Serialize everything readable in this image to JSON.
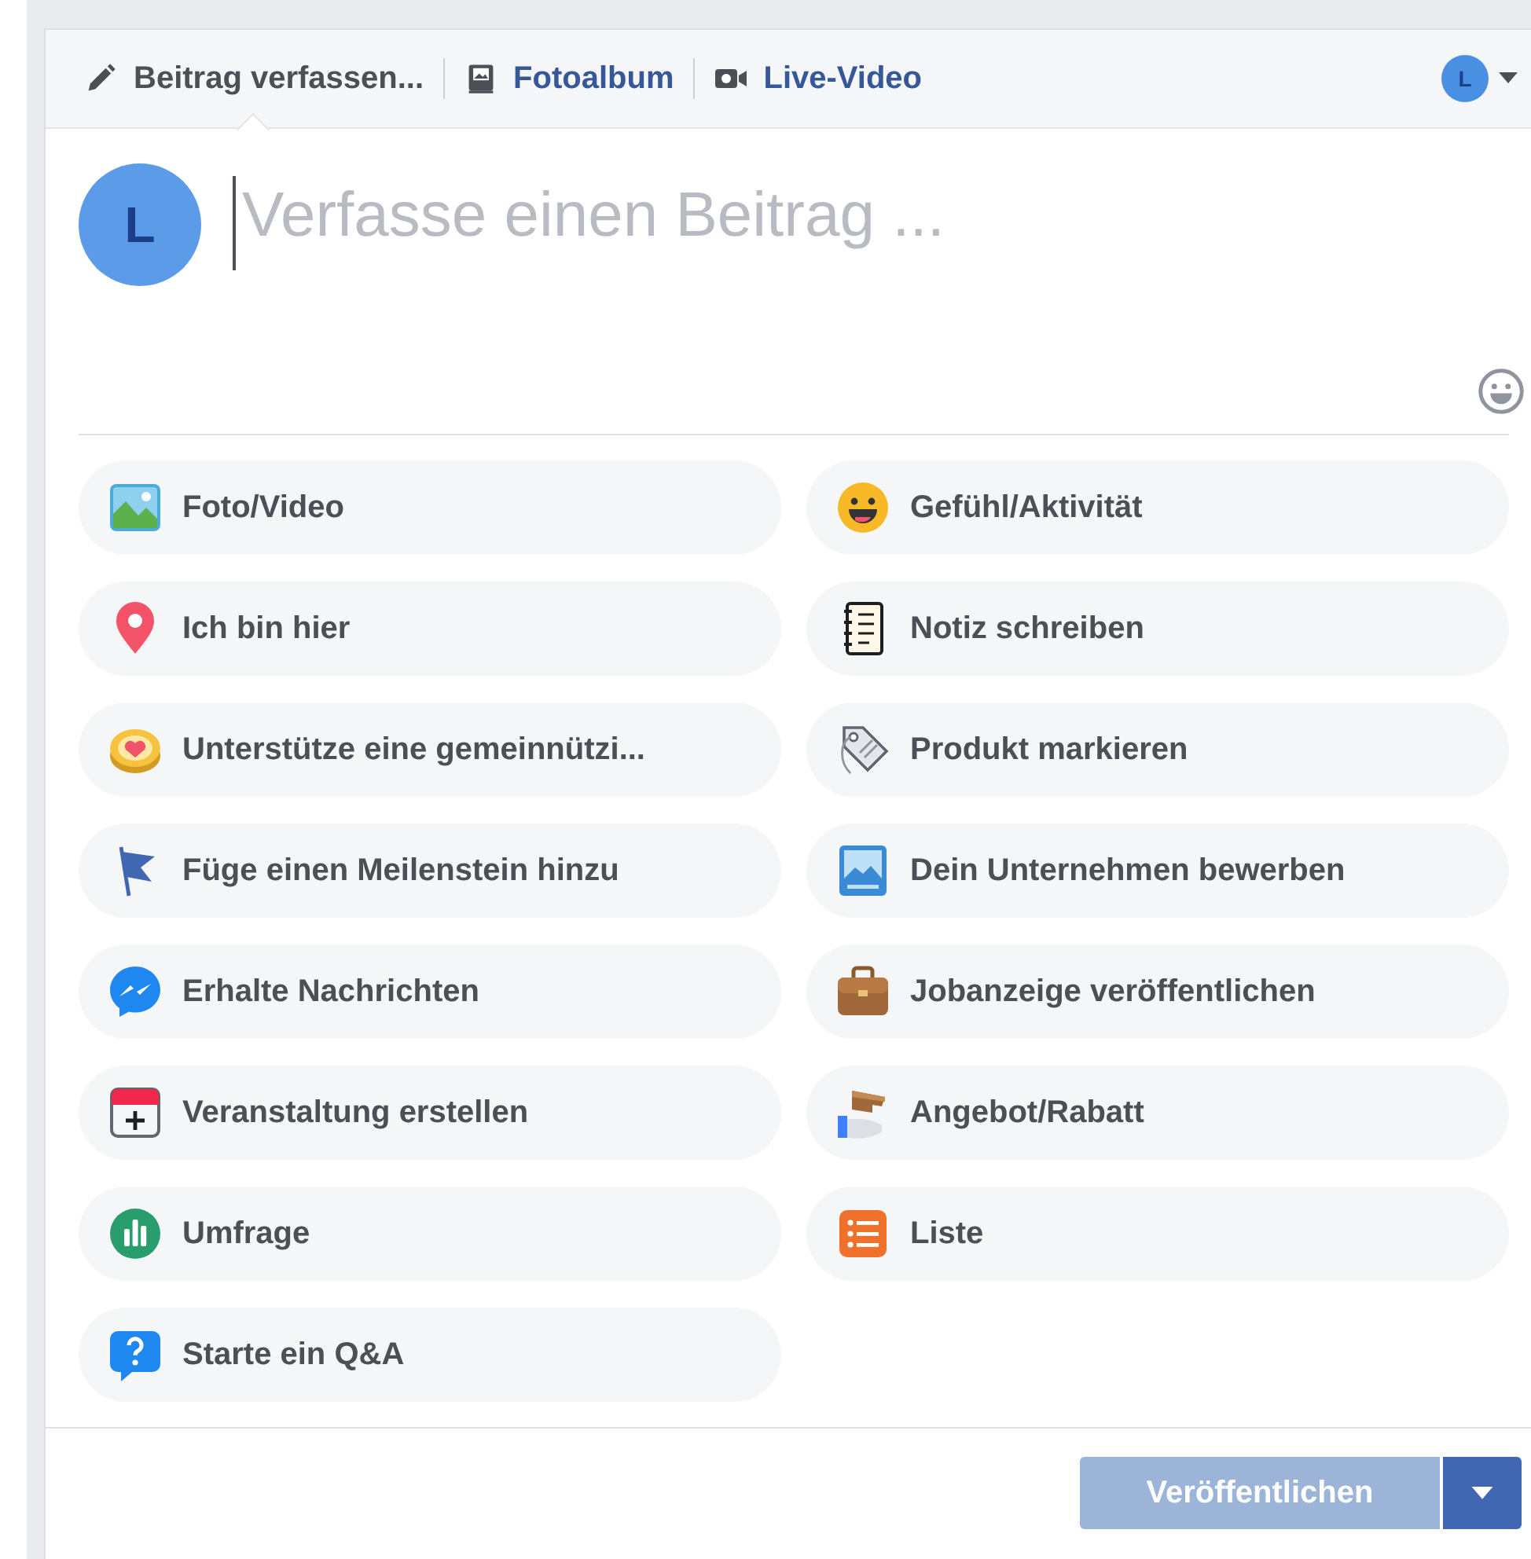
{
  "tabs": [
    {
      "label": "Beitrag verfassen...",
      "selected": true
    },
    {
      "label": "Fotoalbum",
      "selected": false
    },
    {
      "label": "Live-Video",
      "selected": false
    }
  ],
  "account": {
    "avatar_letter": "L"
  },
  "composer": {
    "avatar_letter": "L",
    "placeholder": "Verfasse einen Beitrag ..."
  },
  "actions": [
    {
      "label": "Foto/Video"
    },
    {
      "label": "Gefühl/Aktivität"
    },
    {
      "label": "Ich bin hier"
    },
    {
      "label": "Notiz schreiben"
    },
    {
      "label": "Unterstütze eine gemeinnützi..."
    },
    {
      "label": "Produkt markieren"
    },
    {
      "label": "Füge einen Meilenstein hinzu"
    },
    {
      "label": "Dein Unternehmen bewerben"
    },
    {
      "label": "Erhalte Nachrichten"
    },
    {
      "label": "Jobanzeige veröffentlichen"
    },
    {
      "label": "Veranstaltung erstellen"
    },
    {
      "label": "Angebot/Rabatt"
    },
    {
      "label": "Umfrage"
    },
    {
      "label": "Liste"
    },
    {
      "label": "Starte ein Q&A"
    }
  ],
  "publish": {
    "label": "Veröffentlichen",
    "disabled": true
  }
}
